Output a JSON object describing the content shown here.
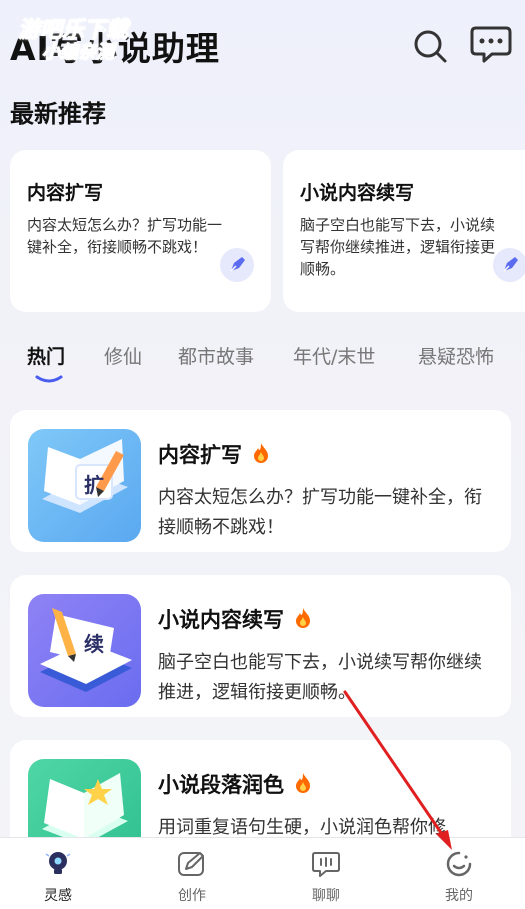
{
  "header": {
    "app_title": "AI写小说助理",
    "watermark_line1": "游吧乐下载",
    "watermark_line2": "小编亲测",
    "search_icon": "search-icon",
    "message_icon": "message-icon"
  },
  "recommend": {
    "section_title": "最新推荐",
    "cards": [
      {
        "title": "内容扩写",
        "desc": "内容太短怎么办？扩写功能一键补全，衔接顺畅不跳戏！",
        "icon": "pen-icon"
      },
      {
        "title": "小说内容续写",
        "desc": "脑子空白也能写下去，小说续写帮你继续推进，逻辑衔接更顺畅。",
        "icon": "pen-icon"
      }
    ]
  },
  "tabs": [
    {
      "label": "热门",
      "active": true
    },
    {
      "label": "修仙",
      "active": false
    },
    {
      "label": "都市故事",
      "active": false
    },
    {
      "label": "年代/末世",
      "active": false
    },
    {
      "label": "悬疑恐怖",
      "active": false
    }
  ],
  "list": [
    {
      "title": "内容扩写",
      "desc": "内容太短怎么办？扩写功能一键补全，衔接顺畅不跳戏！",
      "thumb_char": "扩",
      "badge": "fire-icon"
    },
    {
      "title": "小说内容续写",
      "desc": "脑子空白也能写下去，小说续写帮你继续推进，逻辑衔接更顺畅。",
      "thumb_char": "续",
      "badge": "fire-icon"
    },
    {
      "title": "小说段落润色",
      "desc": "用词重复语句生硬，小说润色帮你修",
      "thumb_char": "",
      "badge": "fire-icon"
    }
  ],
  "bottom_nav": [
    {
      "label": "灵感",
      "icon": "bulb-icon",
      "active": true
    },
    {
      "label": "创作",
      "icon": "create-icon",
      "active": false
    },
    {
      "label": "聊聊",
      "icon": "chat-icon",
      "active": false
    },
    {
      "label": "我的",
      "icon": "profile-icon",
      "active": false
    }
  ],
  "colors": {
    "accent": "#4a5cf0",
    "annotation_arrow": "#e02020",
    "fire": "#ff6a00"
  }
}
